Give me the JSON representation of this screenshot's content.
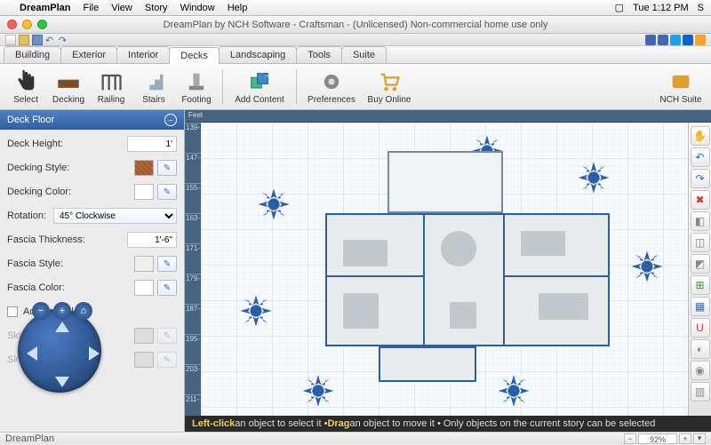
{
  "menubar": {
    "app": "DreamPlan",
    "items": [
      "File",
      "View",
      "Story",
      "Window",
      "Help"
    ],
    "clock": "Tue 1:12 PM",
    "user_initial": "S"
  },
  "window": {
    "title": "DreamPlan by NCH Software - Craftsman - (Unlicensed) Non-commercial home use only"
  },
  "maintabs": [
    "Building",
    "Exterior",
    "Interior",
    "Decks",
    "Landscaping",
    "Tools",
    "Suite"
  ],
  "maintabs_active_index": 3,
  "toolbar": [
    {
      "label": "Select",
      "icon": "hand",
      "name": "select-tool"
    },
    {
      "label": "Decking",
      "icon": "deck",
      "name": "decking-tool"
    },
    {
      "label": "Railing",
      "icon": "rail",
      "name": "railing-tool"
    },
    {
      "label": "Stairs",
      "icon": "stairs",
      "name": "stairs-tool"
    },
    {
      "label": "Footing",
      "icon": "footing",
      "name": "footing-tool"
    },
    {
      "sep": true
    },
    {
      "label": "Add Content",
      "icon": "addcontent",
      "name": "add-content"
    },
    {
      "sep": true
    },
    {
      "label": "Preferences",
      "icon": "prefs",
      "name": "preferences"
    },
    {
      "label": "Buy Online",
      "icon": "cart",
      "name": "buy-online"
    }
  ],
  "toolbar_right": {
    "label": "NCH Suite",
    "name": "nch-suite"
  },
  "panel": {
    "title": "Deck Floor",
    "deck_height": {
      "label": "Deck Height:",
      "value": "1'"
    },
    "decking_style": {
      "label": "Decking Style:"
    },
    "decking_color": {
      "label": "Decking Color:"
    },
    "rotation": {
      "label": "Rotation:",
      "value": "45° Clockwise"
    },
    "fascia_thickness": {
      "label": "Fascia Thickness:",
      "value": "1'-6\""
    },
    "fascia_style": {
      "label": "Fascia Style:"
    },
    "fascia_color": {
      "label": "Fascia Color:"
    },
    "add_skirt": {
      "label": "Add deck skirt"
    },
    "skirt_style": {
      "label": "Skirt Style:"
    },
    "skirt_color": {
      "label": "Skirt Color:"
    }
  },
  "ruler": {
    "unit_label": "Feet",
    "v_ticks": [
      "139-",
      "147-",
      "155-",
      "163-",
      "171-",
      "179-",
      "187-",
      "195-",
      "203-",
      "211-"
    ]
  },
  "right_tools": [
    {
      "name": "pan-tool",
      "glyph": "✋",
      "color": "#2a9d3a"
    },
    {
      "name": "undo",
      "glyph": "↶",
      "color": "#2a6fd1"
    },
    {
      "name": "redo",
      "glyph": "↷",
      "color": "#2a6fd1"
    },
    {
      "name": "delete",
      "glyph": "✖",
      "color": "#d63333"
    },
    {
      "name": "tool-a",
      "glyph": "◧",
      "color": "#888"
    },
    {
      "name": "tool-b",
      "glyph": "◫",
      "color": "#888"
    },
    {
      "name": "tool-c",
      "glyph": "◩",
      "color": "#888"
    },
    {
      "name": "measure",
      "glyph": "⊞",
      "color": "#2a9d3a"
    },
    {
      "name": "grid-toggle",
      "glyph": "▦",
      "color": "#2a6fd1"
    },
    {
      "name": "snap",
      "glyph": "U",
      "color": "#d63333"
    },
    {
      "name": "tool-d",
      "glyph": "◐",
      "color": "#888"
    },
    {
      "name": "tool-e",
      "glyph": "◉",
      "color": "#888"
    },
    {
      "name": "tool-f",
      "glyph": "▥",
      "color": "#888"
    }
  ],
  "hint": {
    "p1a": "Left-click",
    "p1b": " an object to select it • ",
    "p2a": "Drag",
    "p2b": " an object to move it • Only objects on the current story can be selected"
  },
  "status": {
    "left": "DreamPlan",
    "zoom": "92%"
  }
}
